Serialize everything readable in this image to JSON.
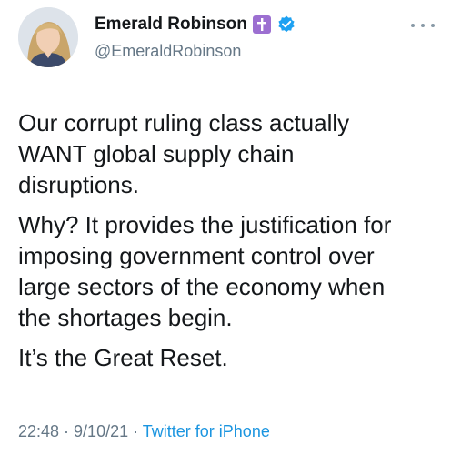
{
  "tweet": {
    "author": {
      "display_name": "Emerald Robinson",
      "handle": "@EmeraldRobinson",
      "badge_icon": "cross-icon",
      "verified_icon": "verified-badge-icon",
      "badge_color": "#9c6fd1",
      "verified_color": "#1da1f2"
    },
    "more_icon": "more-options-icon",
    "paragraphs": [
      "Our corrupt ruling class actually\nWANT global supply chain\ndisruptions.",
      "Why? It provides the justification for\nimposing government control over\nlarge sectors of the economy when\nthe shortages begin.",
      "It’s the Great Reset."
    ],
    "meta": {
      "time": "22:48",
      "separator": " · ",
      "date": "9/10/21",
      "source": "Twitter for iPhone"
    }
  }
}
